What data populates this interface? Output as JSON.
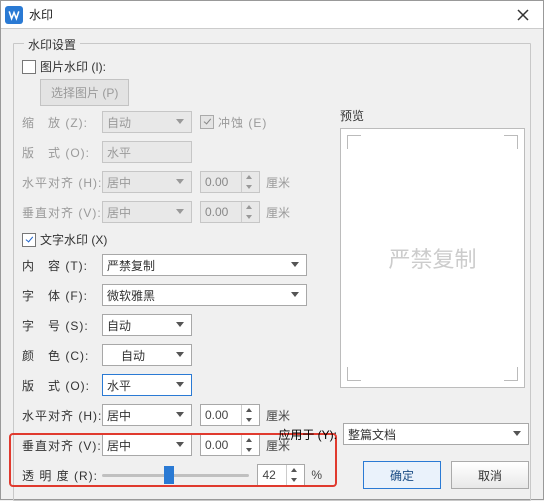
{
  "title": "水印",
  "group_label": "水印设置",
  "image_wm": {
    "checkbox_label": "图片水印 (I):",
    "checked": false,
    "select_btn": "选择图片 (P)",
    "scale_label": "缩　放 (Z):",
    "scale_value": "自动",
    "erode_label": "冲蚀 (E)",
    "layout_label": "版　式 (O):",
    "layout_value": "水平",
    "halign_label": "水平对齐 (H):",
    "halign_value": "居中",
    "halign_num": "0.00",
    "valign_label": "垂直对齐 (V):",
    "valign_value": "居中",
    "valign_num": "0.00",
    "unit": "厘米"
  },
  "text_wm": {
    "checkbox_label": "文字水印 (X)",
    "checked": true,
    "content_label": "内　容 (T):",
    "content_value": "严禁复制",
    "font_label": "字　体 (F):",
    "font_value": "微软雅黑",
    "size_label": "字　号 (S):",
    "size_value": "自动",
    "color_label": "颜　色 (C):",
    "color_value": "自动",
    "layout_label": "版　式 (O):",
    "layout_value": "水平",
    "halign_label": "水平对齐 (H):",
    "halign_value": "居中",
    "halign_num": "0.00",
    "valign_label": "垂直对齐 (V):",
    "valign_value": "居中",
    "valign_num": "0.00",
    "unit": "厘米",
    "opacity_label": "透 明 度 (R):",
    "opacity_value": "42",
    "opacity_unit": "%"
  },
  "preview": {
    "label": "预览",
    "text": "严禁复制"
  },
  "apply": {
    "label": "应用于 (Y):",
    "value": "整篇文档"
  },
  "buttons": {
    "ok": "确定",
    "cancel": "取消"
  }
}
